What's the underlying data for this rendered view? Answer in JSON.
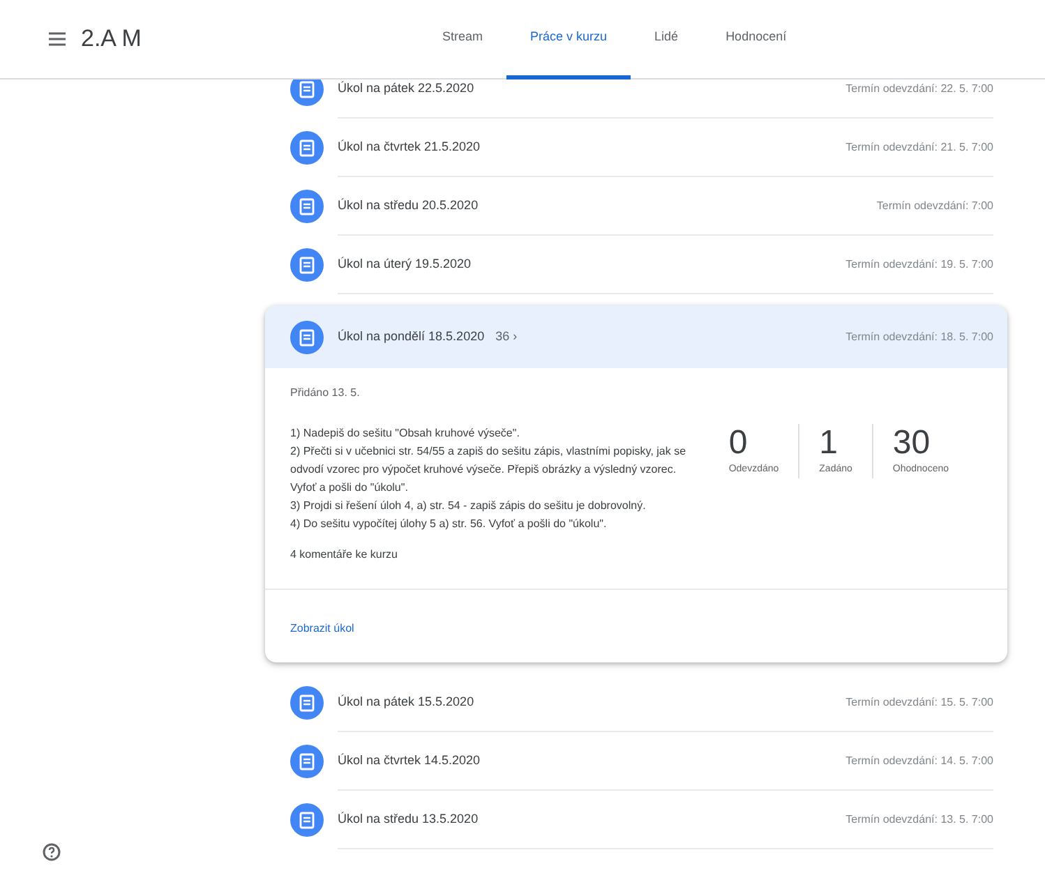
{
  "header": {
    "course_title": "2.A M",
    "tabs": [
      {
        "label": "Stream",
        "selected": false
      },
      {
        "label": "Práce v kurzu",
        "selected": true
      },
      {
        "label": "Lidé",
        "selected": false
      },
      {
        "label": "Hodnocení",
        "selected": false
      }
    ]
  },
  "assignments": [
    {
      "title": "Úkol na pátek 22.5.2020",
      "due": "Termín odevzdání: 22. 5. 7:00",
      "expanded": false
    },
    {
      "title": "Úkol na čtvrtek 21.5.2020",
      "due": "Termín odevzdání: 21. 5. 7:00",
      "expanded": false
    },
    {
      "title": "Úkol na středu 20.5.2020",
      "due": "Termín odevzdání: 7:00",
      "expanded": false
    },
    {
      "title": "Úkol na úterý 19.5.2020",
      "due": "Termín odevzdání: 19. 5. 7:00",
      "expanded": false
    },
    {
      "title": "Úkol na pondělí 18.5.2020",
      "extra": "36 ›",
      "due": "Termín odevzdání: 18. 5. 7:00",
      "expanded": true,
      "posted": "Přidáno 13. 5.",
      "description": [
        "1) Nadepiš do sešitu \"Obsah kruhové výseče\".",
        "2) Přečti si v učebnici str. 54/55 a zapiš do sešitu zápis, vlastními popisky, jak se odvodí vzorec pro výpočet kruhové výseče. Přepiš obrázky a výsledný vzorec. Vyfoť a pošli do \"úkolu\".",
        "3) Projdi si řešení úloh 4, a) str. 54 - zapiš zápis do sešitu je dobrovolný.",
        "4) Do sešitu vypočítej úlohy 5 a) str. 56. Vyfoť a pošli do \"úkolu\"."
      ],
      "comments": "4 komentáře ke kurzu",
      "stats": [
        {
          "value": "0",
          "label": "Odevzdáno"
        },
        {
          "value": "1",
          "label": "Zadáno"
        },
        {
          "value": "30",
          "label": "Ohodnoceno"
        }
      ],
      "link": "Zobrazit úkol"
    },
    {
      "title": "Úkol na pátek 15.5.2020",
      "due": "Termín odevzdání: 15. 5. 7:00",
      "expanded": false
    },
    {
      "title": "Úkol na čtvrtek 14.5.2020",
      "due": "Termín odevzdání: 14. 5. 7:00",
      "expanded": false
    },
    {
      "title": "Úkol na středu 13.5.2020",
      "due": "Termín odevzdání: 13. 5. 7:00",
      "expanded": false
    }
  ]
}
